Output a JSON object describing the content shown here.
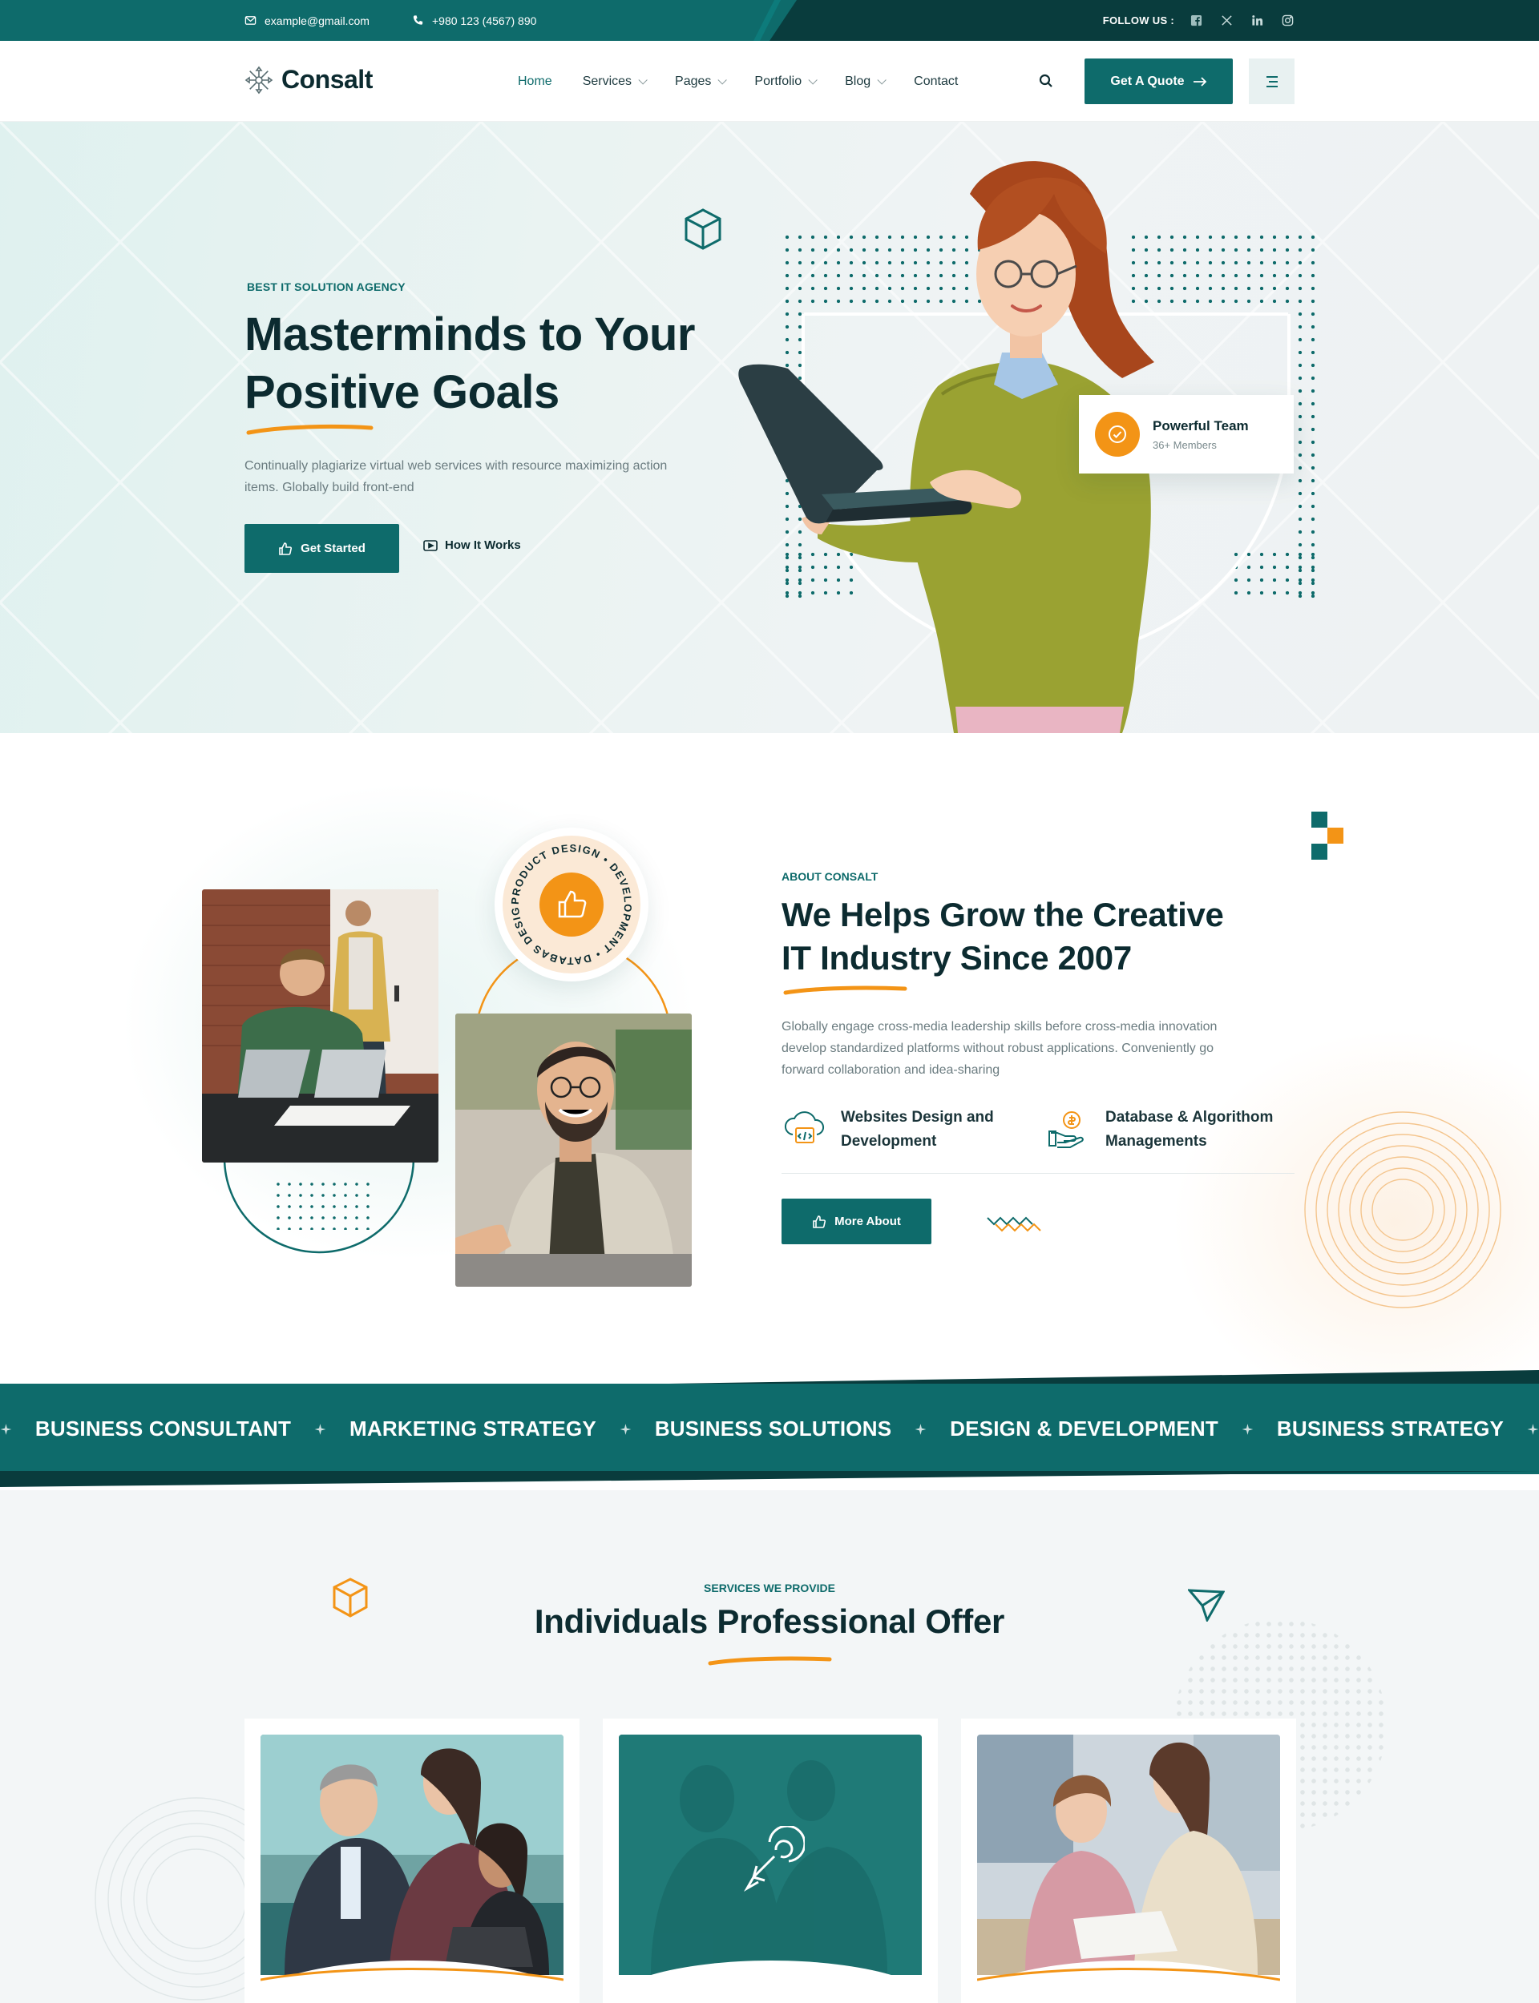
{
  "topbar": {
    "email": "example@gmail.com",
    "phone": "+980 123 (4567) 890",
    "follow_label": "FOLLOW US :",
    "socials": [
      "facebook-icon",
      "x-icon",
      "linkedin-icon",
      "instagram-icon"
    ]
  },
  "header": {
    "logo_text": "Consalt",
    "nav": [
      {
        "label": "Home",
        "active": true
      },
      {
        "label": "Services",
        "dropdown": true
      },
      {
        "label": "Pages",
        "dropdown": true
      },
      {
        "label": "Portfolio",
        "dropdown": true
      },
      {
        "label": "Blog",
        "dropdown": true
      },
      {
        "label": "Contact"
      }
    ],
    "quote_button": "Get A Quote"
  },
  "hero": {
    "subtitle": "BEST IT SOLUTION AGENCY",
    "title_line1": "Masterminds to Your",
    "title_line2": "Positive Goals",
    "text": "Continually plagiarize virtual web services with resource maximizing action items. Globally build front-end",
    "primary_button": "Get Started",
    "secondary_button": "How It Works",
    "team_card": {
      "title": "Powerful Team",
      "subtitle": "36+ Members"
    }
  },
  "about": {
    "badge_text": "PRODUCT DESIGN • DEVELOPMENT • DATABAS DESIGN •",
    "subtitle": "ABOUT CONSALT",
    "title_line1": "We Helps Grow the Creative",
    "title_line2": "IT Industry Since 2007",
    "text": "Globally engage cross-media leadership skills before cross-media innovation develop standardized platforms without robust applications. Conveniently go forward collaboration and idea-sharing",
    "features": [
      {
        "line1": "Websites Design and",
        "line2": "Development",
        "icon": "cloud-code-icon"
      },
      {
        "line1": "Database & Algorithom",
        "line2": "Managements",
        "icon": "money-hand-icon"
      }
    ],
    "button": "More About"
  },
  "ticker": [
    "BUSINESS CONSULTANT",
    "MARKETING STRATEGY",
    "BUSINESS SOLUTIONS",
    "DESIGN & DEVELOPMENT",
    "BUSINESS STRATEGY"
  ],
  "services": {
    "subtitle": "SERVICES WE PROVIDE",
    "title": "Individuals Professional Offer"
  },
  "colors": {
    "primary": "#0e6b6b",
    "dark": "#093c3d",
    "accent": "#f39416",
    "heading": "#0c2b30"
  }
}
